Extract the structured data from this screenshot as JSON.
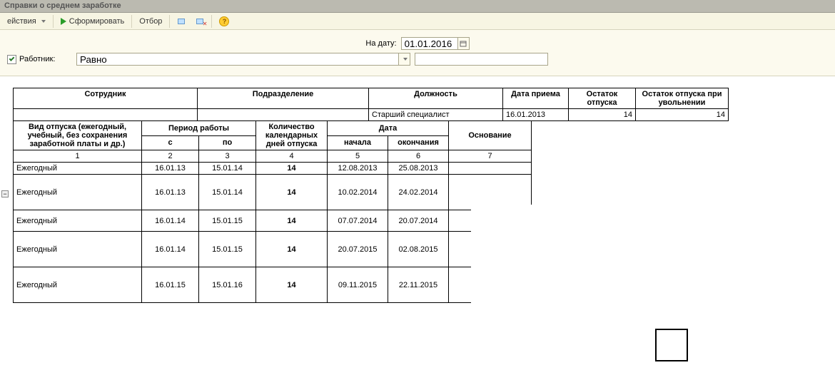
{
  "window_title": "Справки о среднем заработке",
  "toolbar": {
    "actions": "ействия",
    "generate": "Сформировать",
    "filter": "Отбор"
  },
  "params": {
    "date_label": "На дату:",
    "date_value": "01.01.2016",
    "worker_label": "Работник:",
    "worker_checked": true,
    "compare_mode": "Равно",
    "worker_value": ""
  },
  "htable": {
    "headers": [
      "Сотрудник",
      "Подразделение",
      "Должность",
      "Дата приема",
      "Остаток отпуска",
      "Остаток отпуска при увольнении"
    ],
    "row": {
      "employee": "",
      "dept": "",
      "position": "Старший специалист",
      "hire_date": "16.01.2013",
      "remain": "14",
      "remain_dismiss": "14"
    }
  },
  "vtable": {
    "h": {
      "type": "Вид отпуска (ежегодный, учебный, без сохранения заработной платы и др.)",
      "period": "Период работы",
      "period_from": "с",
      "period_to": "по",
      "days": "Количество календарных дней отпуска",
      "date": "Дата",
      "date_start": "начала",
      "date_end": "окончания",
      "basis": "Основание"
    },
    "colnums": [
      "1",
      "2",
      "3",
      "4",
      "5",
      "6",
      "7"
    ],
    "rows": [
      {
        "type": "Ежегодный",
        "from": "16.01.13",
        "to": "15.01.14",
        "days": "14",
        "start": "12.08.2013",
        "end": "25.08.2013",
        "basis": ""
      },
      {
        "type": "Ежегодный",
        "from": "16.01.13",
        "to": "15.01.14",
        "days": "14",
        "start": "10.02.2014",
        "end": "24.02.2014",
        "basis": ""
      },
      {
        "type": "Ежегодный",
        "from": "16.01.14",
        "to": "15.01.15",
        "days": "14",
        "start": "07.07.2014",
        "end": "20.07.2014",
        "basis": ""
      },
      {
        "type": "Ежегодный",
        "from": "16.01.14",
        "to": "15.01.15",
        "days": "14",
        "start": "20.07.2015",
        "end": "02.08.2015",
        "basis": ""
      },
      {
        "type": "Ежегодный",
        "from": "16.01.15",
        "to": "15.01.16",
        "days": "14",
        "start": "09.11.2015",
        "end": "22.11.2015",
        "basis": ""
      }
    ]
  }
}
